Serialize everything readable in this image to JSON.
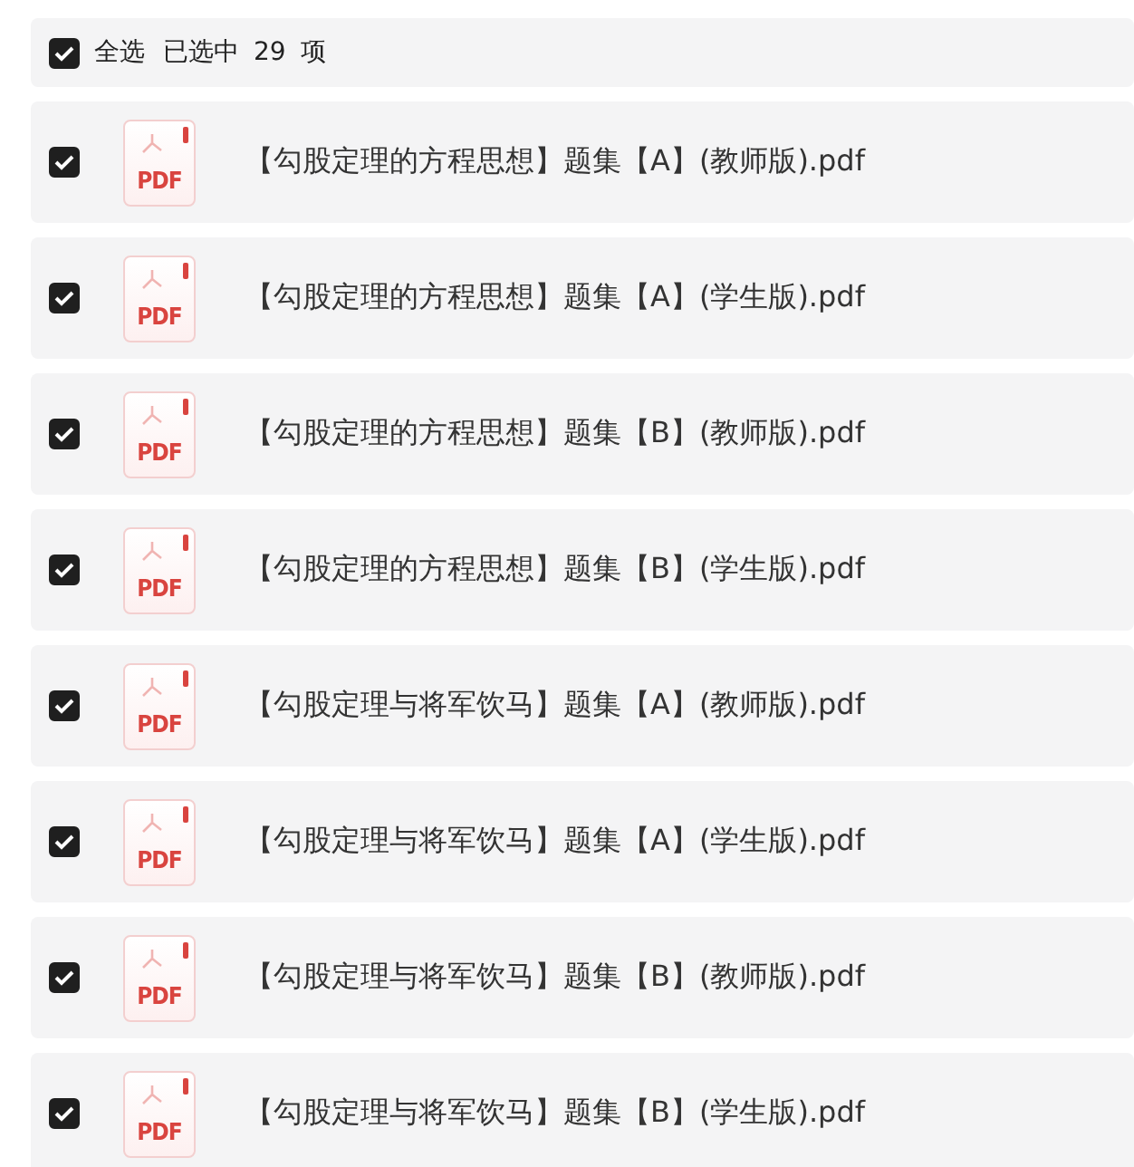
{
  "header": {
    "checked": true,
    "select_all": "全选",
    "selected_text": "已选中",
    "count": "29",
    "unit": "项"
  },
  "files": [
    {
      "name": "【勾股定理的方程思想】题集【A】(教师版).pdf",
      "checked": true,
      "type_label": "PDF"
    },
    {
      "name": "【勾股定理的方程思想】题集【A】(学生版).pdf",
      "checked": true,
      "type_label": "PDF"
    },
    {
      "name": "【勾股定理的方程思想】题集【B】(教师版).pdf",
      "checked": true,
      "type_label": "PDF"
    },
    {
      "name": "【勾股定理的方程思想】题集【B】(学生版).pdf",
      "checked": true,
      "type_label": "PDF"
    },
    {
      "name": "【勾股定理与将军饮马】题集【A】(教师版).pdf",
      "checked": true,
      "type_label": "PDF"
    },
    {
      "name": "【勾股定理与将军饮马】题集【A】(学生版).pdf",
      "checked": true,
      "type_label": "PDF"
    },
    {
      "name": "【勾股定理与将军饮马】题集【B】(教师版).pdf",
      "checked": true,
      "type_label": "PDF"
    },
    {
      "name": "【勾股定理与将军饮马】题集【B】(学生版).pdf",
      "checked": true,
      "type_label": "PDF"
    }
  ]
}
